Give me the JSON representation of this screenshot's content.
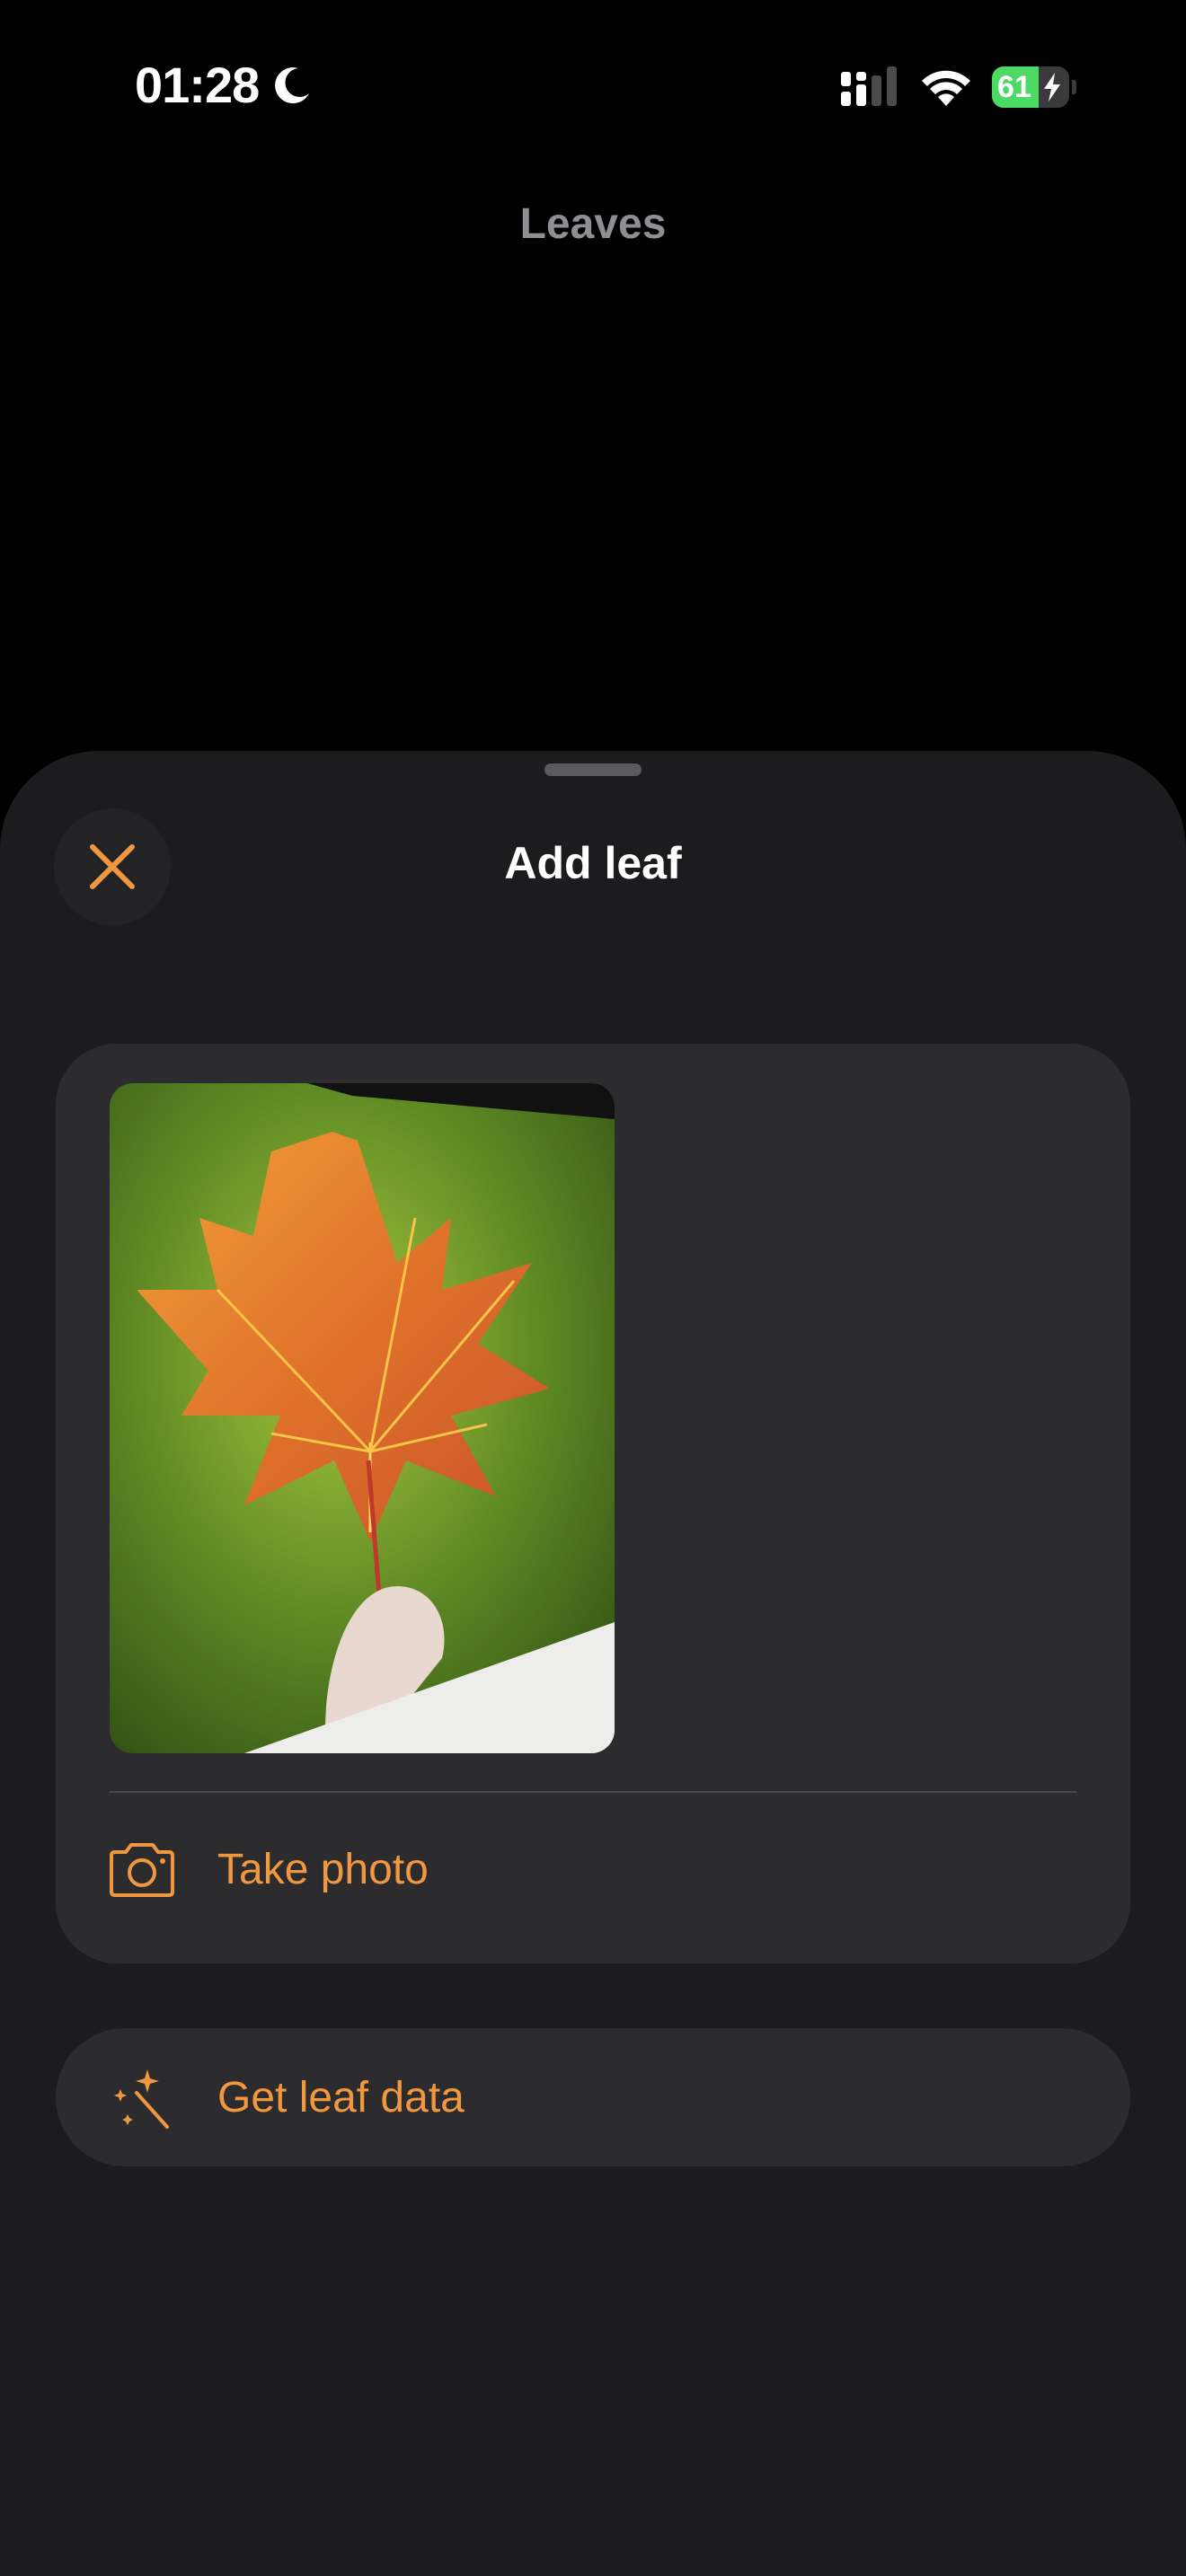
{
  "status_bar": {
    "time": "01:28",
    "moon_icon": "moon-icon",
    "battery_level": 61,
    "battery_text": "61",
    "battery_color": "#4cd964"
  },
  "background_screen": {
    "title": "Leaves"
  },
  "sheet": {
    "title": "Add leaf",
    "close_icon": "close-icon",
    "accent_color": "#f0973f",
    "photo_card": {
      "photo_description_icon": "leaf-photo",
      "take_photo_label": "Take photo",
      "take_photo_icon": "camera-icon"
    },
    "get_leaf_data": {
      "label": "Get leaf data",
      "icon": "magic-wand-icon"
    }
  }
}
